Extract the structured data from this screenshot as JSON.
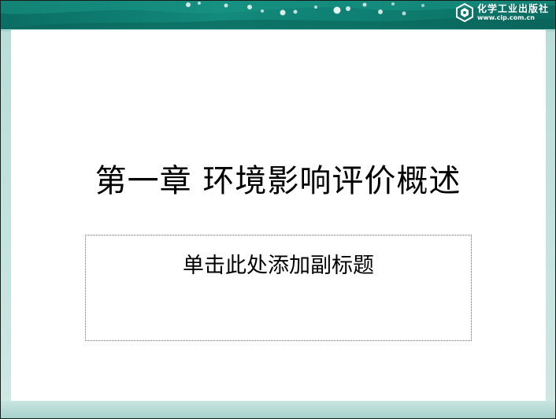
{
  "header": {
    "logo_icon": "publisher-logo-icon",
    "publisher_name": "化学工业出版社",
    "publisher_url": "www.cip.com.cn",
    "band_color": "#0e7f73"
  },
  "slide": {
    "title": "第一章 环境影响评价概述",
    "subtitle_placeholder": "单击此处添加副标题"
  },
  "colors": {
    "accent": "#0e7f73",
    "light_band": "#cfe8e4",
    "text": "#000000"
  }
}
